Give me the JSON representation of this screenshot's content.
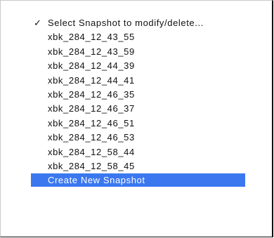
{
  "popup_menu": {
    "header": {
      "check_glyph": "✓",
      "label": "Select Snapshot to modify/delete..."
    },
    "snapshots": [
      "xbk_284_12_43_55",
      "xbk_284_12_43_59",
      "xbk_284_12_44_39",
      "xbk_284_12_44_41",
      "xbk_284_12_46_35",
      "xbk_284_12_46_37",
      "xbk_284_12_46_51",
      "xbk_284_12_46_53",
      "xbk_284_12_58_44",
      "xbk_284_12_58_45"
    ],
    "create_label": "Create New Snapshot",
    "colors": {
      "highlight": "#3b78f0",
      "highlight_text": "#ffffff",
      "text": "#111111"
    }
  }
}
